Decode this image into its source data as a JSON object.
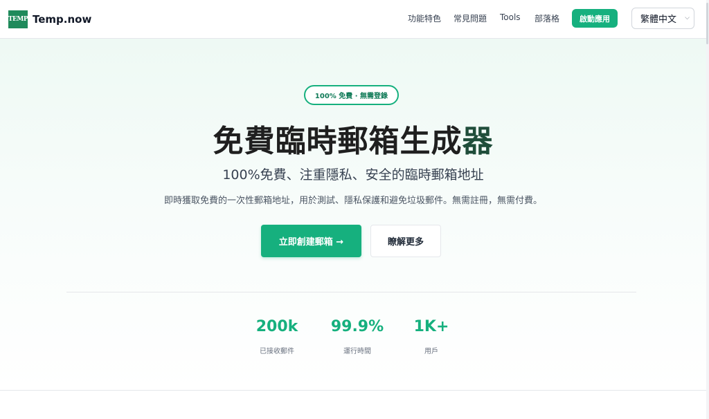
{
  "header": {
    "logo_text": "TEMP",
    "brand": "Temp.now",
    "nav": [
      "功能特色",
      "常見問題",
      "Tools",
      "部落格"
    ],
    "launch_label": "啟動應用",
    "language": "繁體中文"
  },
  "hero": {
    "badge": "100% 免費 · 無需登錄",
    "title_main": "免費臨時郵箱生成",
    "title_accent": "器",
    "subtitle": "100%免費、注重隱私、安全的臨時郵箱地址",
    "description": "即時獲取免費的一次性郵箱地址，用於測試、隱私保護和避免垃圾郵件。無需註冊，無需付費。",
    "primary_cta": "立即創建郵箱 →",
    "secondary_cta": "瞭解更多"
  },
  "stats": [
    {
      "value": "200k",
      "label": "已接收郵件"
    },
    {
      "value": "99.9%",
      "label": "運行時間"
    },
    {
      "value": "1K+",
      "label": "用戶"
    }
  ],
  "colors": {
    "accent": "#16b07e",
    "title_accent": "#1f4d3a",
    "logo_bg": "#1f8a5b"
  }
}
